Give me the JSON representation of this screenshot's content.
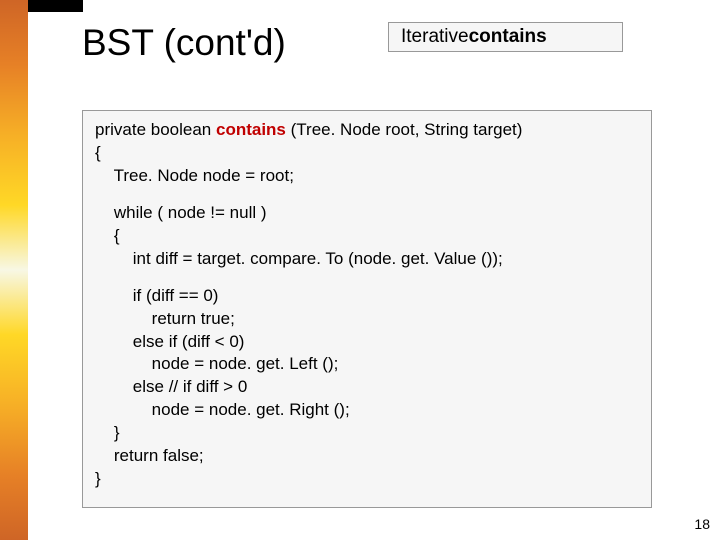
{
  "title": "BST (cont'd)",
  "label": {
    "prefix": "Iterative ",
    "bold": "contains"
  },
  "code": {
    "sig_pre": "private boolean ",
    "sig_red": "contains",
    "sig_post": " (Tree. Node root, String target)",
    "l1": "{",
    "l2": "    Tree. Node node = root;",
    "l3": "    while ( node != null )",
    "l4": "    {",
    "l5": "        int diff = target. compare. To (node. get. Value ());",
    "l6": "        if (diff == 0)",
    "l7": "            return true;",
    "l8": "        else if (diff < 0)",
    "l9": "            node = node. get. Left ();",
    "l10": "        else // if diff > 0",
    "l11": "            node = node. get. Right ();",
    "l12": "    }",
    "l13": "    return false;",
    "l14": "}"
  },
  "page_number": "18"
}
